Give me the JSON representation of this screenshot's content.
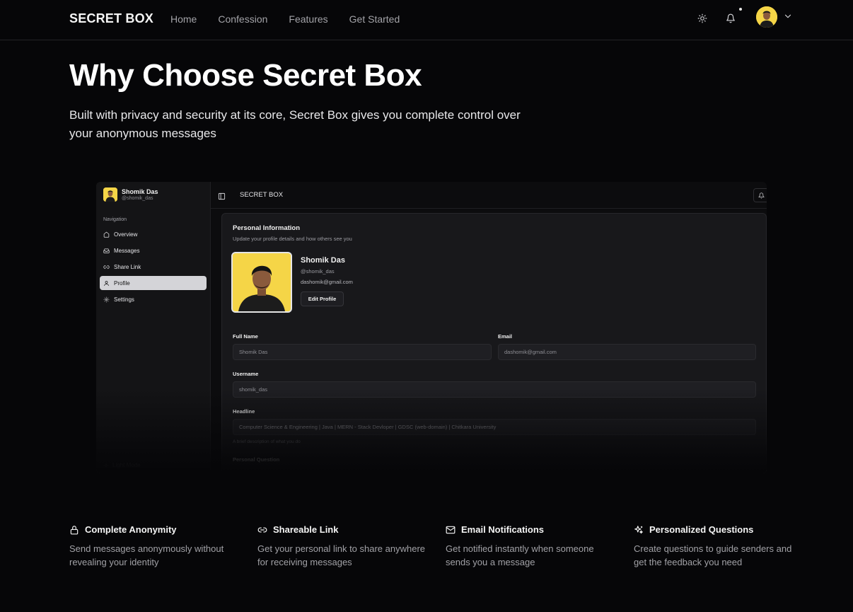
{
  "nav": {
    "brand": "SECRET BOX",
    "links": [
      "Home",
      "Confession",
      "Features",
      "Get Started"
    ]
  },
  "hero": {
    "title": "Why Choose Secret Box",
    "subtitle": "Built with privacy and security at its core, Secret Box gives you complete control over your anonymous messages"
  },
  "preview": {
    "user": {
      "name": "Shomik Das",
      "handle": "@shomik_das"
    },
    "nav_label": "Navigation",
    "nav_items": [
      {
        "label": "Overview",
        "icon": "home-icon"
      },
      {
        "label": "Messages",
        "icon": "inbox-icon"
      },
      {
        "label": "Share Link",
        "icon": "link-icon"
      },
      {
        "label": "Profile",
        "icon": "user-icon",
        "active": true
      },
      {
        "label": "Settings",
        "icon": "gear-icon"
      }
    ],
    "light_mode": "Light Mode",
    "header_title": "SECRET BOX",
    "card": {
      "title": "Personal Information",
      "subtitle": "Update your profile details and how others see you",
      "name": "Shomik Das",
      "handle": "@shomik_das",
      "email": "dashomik@gmail.com",
      "edit_button": "Edit Profile"
    },
    "form": {
      "full_name_label": "Full Name",
      "full_name_value": "Shomik Das",
      "email_label": "Email",
      "email_value": "dashomik@gmail.com",
      "username_label": "Username",
      "username_value": "shomik_das",
      "headline_label": "Headline",
      "headline_value": "Computer Science & Engineering | Java | MERN - Stack Devloper | GDSC (web-domain) | Chitkara University",
      "headline_hint": "A brief description of what you do",
      "personal_question_label": "Personal Question"
    }
  },
  "features": [
    {
      "title": "Complete Anonymity",
      "desc": "Send messages anonymously without revealing your identity",
      "icon": "lock-icon"
    },
    {
      "title": "Shareable Link",
      "desc": "Get your personal link to share anywhere for receiving messages",
      "icon": "link-icon"
    },
    {
      "title": "Email Notifications",
      "desc": "Get notified instantly when someone sends you a message",
      "icon": "mail-icon"
    },
    {
      "title": "Personalized Questions",
      "desc": "Create questions to guide senders and get the feedback you need",
      "icon": "sparkles-icon"
    }
  ],
  "colors": {
    "background": "#060608",
    "accent_avatar": "#f5d547"
  }
}
